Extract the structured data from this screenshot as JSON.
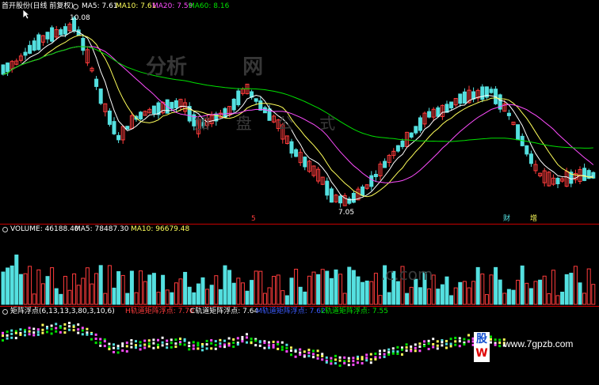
{
  "header": {
    "stock_name": "首开股份(日线 前复权)",
    "ma5": "MA5: 7.61",
    "ma10": "MA10: 7.61",
    "ma20": "MA20: 7.59",
    "ma60": "MA60: 8.16"
  },
  "price_panel": {
    "high_label": "10.08",
    "low_label": "7.05",
    "marker_red": "5",
    "marker_finance": "财",
    "marker_increase": "增"
  },
  "volume_panel": {
    "volume": "VOLUME: 46188.40",
    "ma5": "MA5: 78487.30",
    "ma10": "MA10: 96679.48"
  },
  "matrix_panel": {
    "title": "矩阵浮点(6,13,13,3,80,3,10,6)",
    "h_label": "H轨道矩阵浮点: 7.70",
    "c_label": "C轨道矩阵浮点: 7.64",
    "m_label": "M轨道矩阵浮点: 7.62",
    "l_label": "L轨道矩阵浮点: 7.55"
  },
  "watermark": {
    "site": "www.7gpzb.com"
  },
  "colors": {
    "up": "#ff3c3c",
    "down": "#54e0e0",
    "ma5": "#ffffff",
    "ma10": "#ffff5a",
    "ma20": "#ff4dff",
    "ma60": "#00e000",
    "divider": "#c80000"
  }
}
